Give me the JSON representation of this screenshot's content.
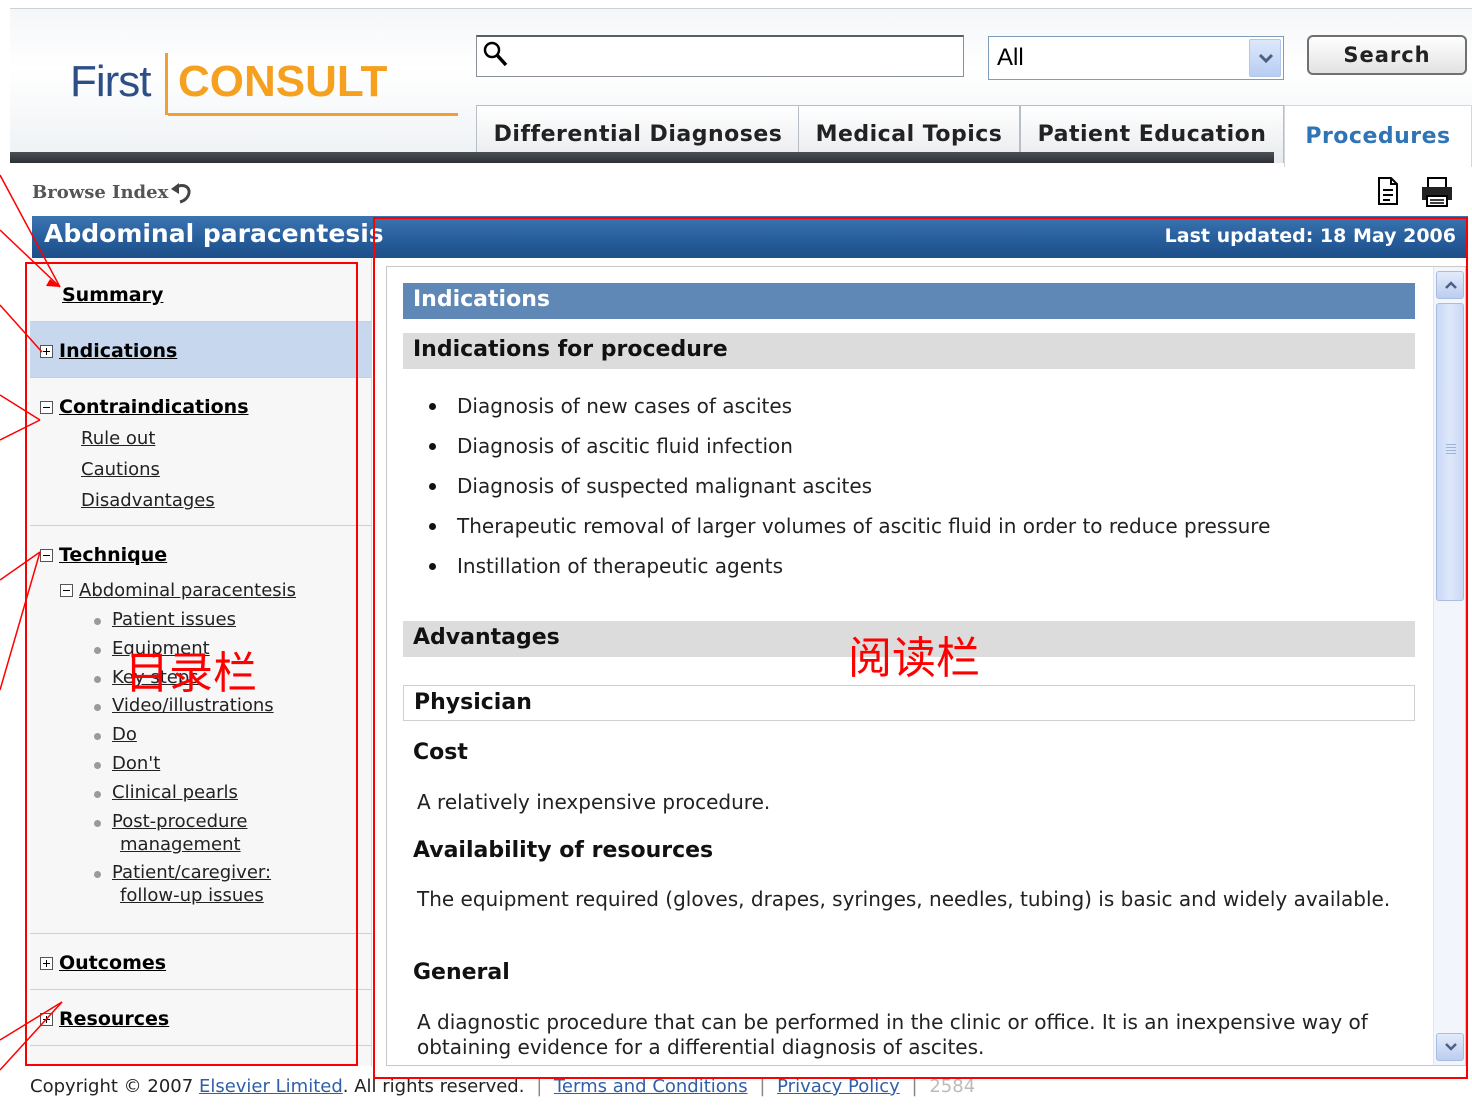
{
  "logo": {
    "first": "First",
    "consult": "CONSULT"
  },
  "search": {
    "value": "",
    "scope": "All",
    "button_label": "Search"
  },
  "tabs": [
    {
      "label": "Differential Diagnoses",
      "active": false
    },
    {
      "label": "Medical Topics",
      "active": false
    },
    {
      "label": "Patient Education",
      "active": false
    },
    {
      "label": "Procedures",
      "active": true
    }
  ],
  "browse_index": "Browse Index",
  "doc": {
    "title": "Abdominal paracentesis",
    "last_updated": "Last updated: 18 May 2006"
  },
  "toc": {
    "summary": "Summary",
    "indications": "Indications",
    "contraindications": "Contraindications",
    "contraindications_items": [
      "Rule out",
      "Cautions",
      "Disadvantages"
    ],
    "technique": "Technique",
    "technique_sub": "Abdominal paracentesis",
    "technique_items": [
      "Patient issues",
      "Equipment",
      "Key steps",
      "Video/illustrations",
      "Do",
      "Don't",
      "Clinical pearls"
    ],
    "post_procedure": [
      "Post-procedure",
      "management"
    ],
    "caregiver": [
      "Patient/caregiver:",
      "follow-up issues"
    ],
    "outcomes": "Outcomes",
    "resources": "Resources"
  },
  "content": {
    "section_title": "Indications",
    "indications_heading": "Indications for procedure",
    "indications_items": [
      "Diagnosis of new cases of ascites",
      "Diagnosis of ascitic fluid infection",
      "Diagnosis of suspected malignant ascites",
      "Therapeutic removal of larger volumes of ascitic fluid in order to reduce pressure",
      "Instillation of therapeutic agents"
    ],
    "advantages_heading": "Advantages",
    "physician_heading": "Physician",
    "cost_heading": "Cost",
    "cost_text": "A relatively inexpensive procedure.",
    "availability_heading": "Availability of resources",
    "availability_text": "The equipment required (gloves, drapes, syringes, needles, tubing) is basic and widely available.",
    "general_heading": "General",
    "general_text": "A diagnostic procedure that can be performed in the clinic or office. It is an inexpensive way of obtaining evidence for a differential diagnosis of ascites."
  },
  "footer": {
    "copyright_prefix": "Copyright © 2007",
    "elsevier_link": "Elsevier Limited",
    "rights": ". All rights reserved.",
    "terms_link": "Terms and Conditions",
    "privacy_link": "Privacy Policy",
    "page_code": "2584"
  },
  "annotations": {
    "toc_label": "目录栏",
    "reading_label": "阅读栏",
    "color": "#ff0000"
  },
  "colors": {
    "title_bar": "#255c9a",
    "active_tab_text": "#2f74b5",
    "logo_blue": "#2d4f86",
    "logo_orange": "#f5a11f"
  },
  "icons": {
    "search": "magnifier-icon",
    "select": "dropdown-arrow-icon",
    "browse": "back-arrow-icon",
    "page": "document-icon",
    "print": "printer-icon"
  }
}
